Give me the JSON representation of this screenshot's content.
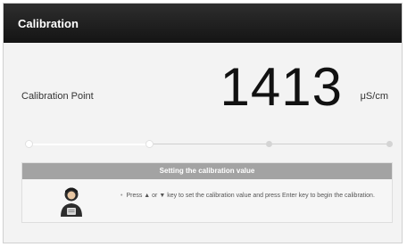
{
  "window": {
    "title": "Calibration"
  },
  "reading": {
    "label": "Calibration Point",
    "value": "1413",
    "unit": "μS/cm"
  },
  "progress": {
    "total_steps": 4,
    "completed_steps": 2
  },
  "instruction_panel": {
    "header": "Setting the calibration value",
    "icon": "user-icon",
    "bullet": "•",
    "text": "Press ▲ or ▼ key to set the calibration value and press Enter key to begin the calibration."
  },
  "colors": {
    "titlebar": "#1e1e1e",
    "panel_header": "#a3a3a3",
    "step_done": "#ffffff",
    "step_pending": "#d4d4d4"
  }
}
